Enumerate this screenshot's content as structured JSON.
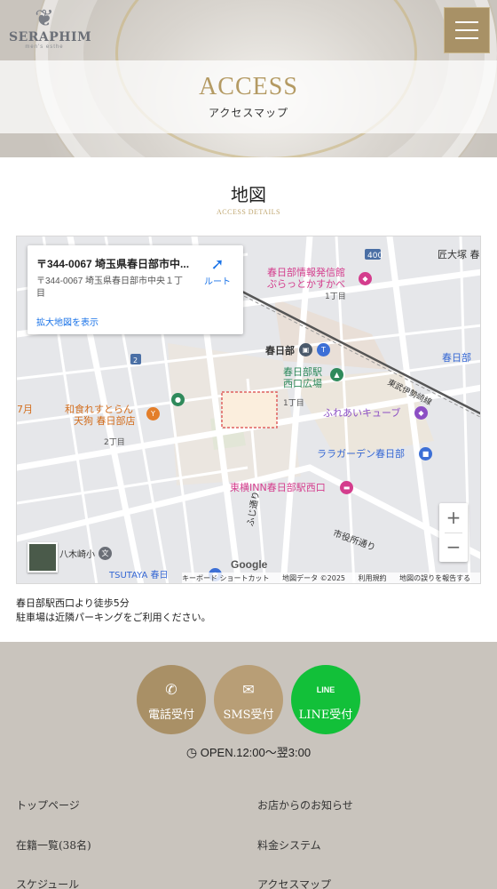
{
  "brand": {
    "logo_text": "SERAPHIM",
    "logo_sub": "men's esthe"
  },
  "header": {
    "menu_icon": "hamburger-icon"
  },
  "page": {
    "title_en": "ACCESS",
    "title_ja": "アクセスマップ"
  },
  "section": {
    "title": "地図",
    "subtitle": "ACCESS DETAILS"
  },
  "map": {
    "card_title": "〒344-0067 埼玉県春日部市中...",
    "card_address": "〒344-0067 埼玉県春日部市中央１丁目",
    "card_link": "拡大地図を表示",
    "route_label": "ルート",
    "pois": {
      "info_center_1": "春日部情報発信館",
      "info_center_2": "ぷらっとかすかべ",
      "station": "春日部",
      "west_plaza_1": "春日部駅",
      "west_plaza_2": "西口広場",
      "tobu_line": "東武伊勢崎線",
      "fureai": "ふれあいキューブ",
      "lalagarden": "ララガーデン春日部",
      "toyoko": "東横INN春日部駅西口",
      "wasure_1": "和食れすとらん",
      "wasure_2": "天狗 春日部店",
      "yagisaki": "八木崎小",
      "tsutaya": "TSUTAYA 春日",
      "fujidori": "ふじ通り",
      "shiyakusho": "市役所通り",
      "takumi": "匠大塚 春",
      "kasukabe_right": "春日部",
      "chome_1": "1丁目",
      "chome_1b": "1丁目",
      "chome_2": "2丁目",
      "route_400": "400",
      "route_2": "2",
      "left_7": "7月"
    },
    "zoom_in": "+",
    "zoom_out": "−",
    "google": "Google",
    "attribution": [
      "キーボード ショートカット",
      "地図データ ©2025",
      "利用規約",
      "地図の誤りを報告する"
    ]
  },
  "access": {
    "line1": "春日部駅西口より徒歩5分",
    "line2": "駐車場は近隣パーキングをご利用ください。"
  },
  "contacts": [
    {
      "label": "電話受付",
      "icon": "phone-icon",
      "color": "#a99066"
    },
    {
      "label": "SMS受付",
      "icon": "sms-icon",
      "color": "#b89e76"
    },
    {
      "label": "LINE受付",
      "icon": "line-icon",
      "color": "#12c039"
    }
  ],
  "hours": "OPEN.12:00〜翌3:00",
  "footer_nav": {
    "top": "トップページ",
    "news": "お店からのお知らせ",
    "roster": "在籍一覧(38名)",
    "price": "料金システム",
    "schedule": "スケジュール",
    "access": "アクセスマップ"
  }
}
